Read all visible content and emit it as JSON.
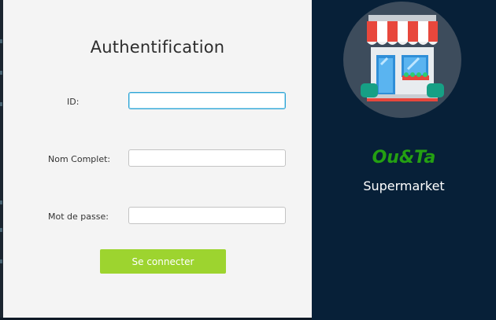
{
  "login": {
    "title": "Authentification",
    "fields": [
      {
        "label": "ID:",
        "value": "",
        "placeholder": ""
      },
      {
        "label": "Nom Complet:",
        "value": "",
        "placeholder": ""
      },
      {
        "label": "Mot de passe:",
        "value": "",
        "placeholder": ""
      }
    ],
    "connect_label": "Se connecter"
  },
  "brand": {
    "name": "Ou&Ta",
    "subtitle": "Supermarket",
    "logo_icon": "store-icon"
  },
  "colors": {
    "panel_bg": "#f4f4f4",
    "brand_bg": "#072038",
    "button": "#9dd42f",
    "brand_name": "#24a012",
    "focus_border": "#2ea4d6"
  }
}
